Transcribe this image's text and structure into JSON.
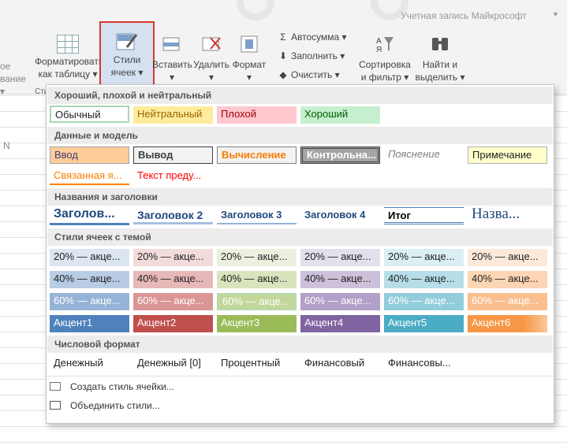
{
  "account": {
    "label": "Учетная запись Майкрософт"
  },
  "ribbon": {
    "left_partial": [
      "ое",
      "вание"
    ],
    "format_table": [
      "Форматировать",
      "как таблицу"
    ],
    "cell_styles": [
      "Стили",
      "ячеек"
    ],
    "insert": "Вставить",
    "delete": "Удалить",
    "format": "Формат",
    "autosum": "Автосумма",
    "fill": "Заполнить",
    "clear": "Очистить",
    "sort_filter": [
      "Сортировка",
      "и фильтр"
    ],
    "find_select": [
      "Найти и",
      "выделить"
    ],
    "group_partial": "Сти"
  },
  "sheet": {
    "column_letter": "N"
  },
  "gallery": {
    "sections": {
      "good_bad": "Хороший, плохой и нейтральный",
      "data_model": "Данные и модель",
      "titles": "Названия и заголовки",
      "theme": "Стили ячеек с темой",
      "number": "Числовой формат"
    },
    "good_bad": [
      "Обычный",
      "Нейтральный",
      "Плохой",
      "Хороший"
    ],
    "data_model_row1": [
      "Ввод",
      "Вывод",
      "Вычисление",
      "Контрольна...",
      "Пояснение",
      "Примечание"
    ],
    "data_model_row2": [
      "Связанная я...",
      "Текст преду..."
    ],
    "titles": [
      "Заголов...",
      "Заголовок 2",
      "Заголовок 3",
      "Заголовок 4",
      "Итог",
      "Назва..."
    ],
    "theme_20": [
      "20% — акце...",
      "20% — акце...",
      "20% — акце...",
      "20% — акце...",
      "20% — акце...",
      "20% — акце..."
    ],
    "theme_40": [
      "40% — акце...",
      "40% — акце...",
      "40% — акце...",
      "40% — акце...",
      "40% — акце...",
      "40% — акце..."
    ],
    "theme_60": [
      "60% — акце...",
      "60% — акце...",
      "60% — акце...",
      "60% — акце...",
      "60% — акце...",
      "60% — акце..."
    ],
    "accents": [
      "Акцент1",
      "Акцент2",
      "Акцент3",
      "Акцент4",
      "Акцент5",
      "Акцент6"
    ],
    "number_formats": [
      "Денежный",
      "Денежный [0]",
      "Процентный",
      "Финансовый",
      "Финансовы..."
    ],
    "commands": {
      "new_style": "Создать стиль ячейки...",
      "merge_styles": "Объединить стили..."
    }
  },
  "colors": {
    "highlight_border": "#d9372b",
    "accent1": "#4f81bd",
    "accent2": "#c0504d",
    "accent3": "#9bbb59",
    "accent4": "#8064a2",
    "accent5": "#4bacc6",
    "accent6": "#f79646"
  }
}
